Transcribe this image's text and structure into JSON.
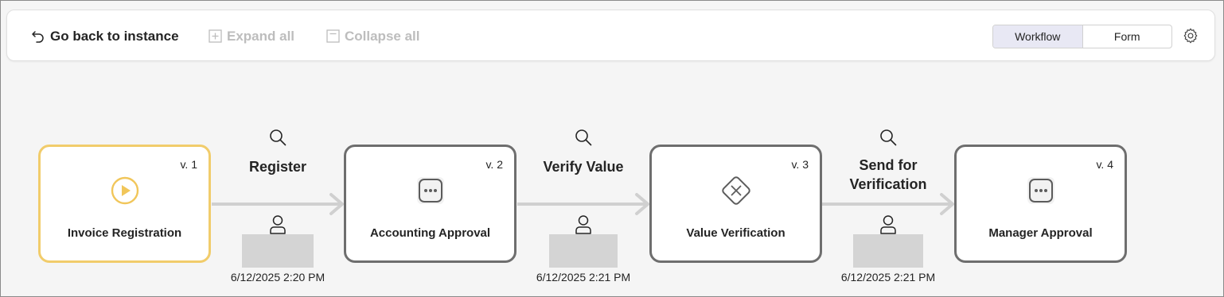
{
  "toolbar": {
    "back_label": "Go back to instance",
    "expand_label": "Expand all",
    "collapse_label": "Collapse all",
    "view_tabs": [
      "Workflow",
      "Form"
    ],
    "active_view": "Workflow"
  },
  "colors": {
    "start_node_border": "#f1cc6b",
    "node_border": "#6e6e6e",
    "active_tab_bg": "#e8e8f4",
    "arrow": "#d0d0d0"
  },
  "workflow": {
    "nodes": [
      {
        "label": "Invoice Registration",
        "version": "v. 1",
        "icon": "play-circle-icon"
      },
      {
        "label": "Accounting Approval",
        "version": "v. 2",
        "icon": "more-dots-icon"
      },
      {
        "label": "Value Verification",
        "version": "v. 3",
        "icon": "diamond-x-icon"
      },
      {
        "label": "Manager Approval",
        "version": "v. 4",
        "icon": "more-dots-icon"
      }
    ],
    "transitions": [
      {
        "label": "Register",
        "timestamp": "6/12/2025 2:20 PM"
      },
      {
        "label": "Verify Value",
        "timestamp": "6/12/2025 2:21 PM"
      },
      {
        "label": "Send for Verification",
        "timestamp": "6/12/2025 2:21 PM"
      }
    ]
  }
}
